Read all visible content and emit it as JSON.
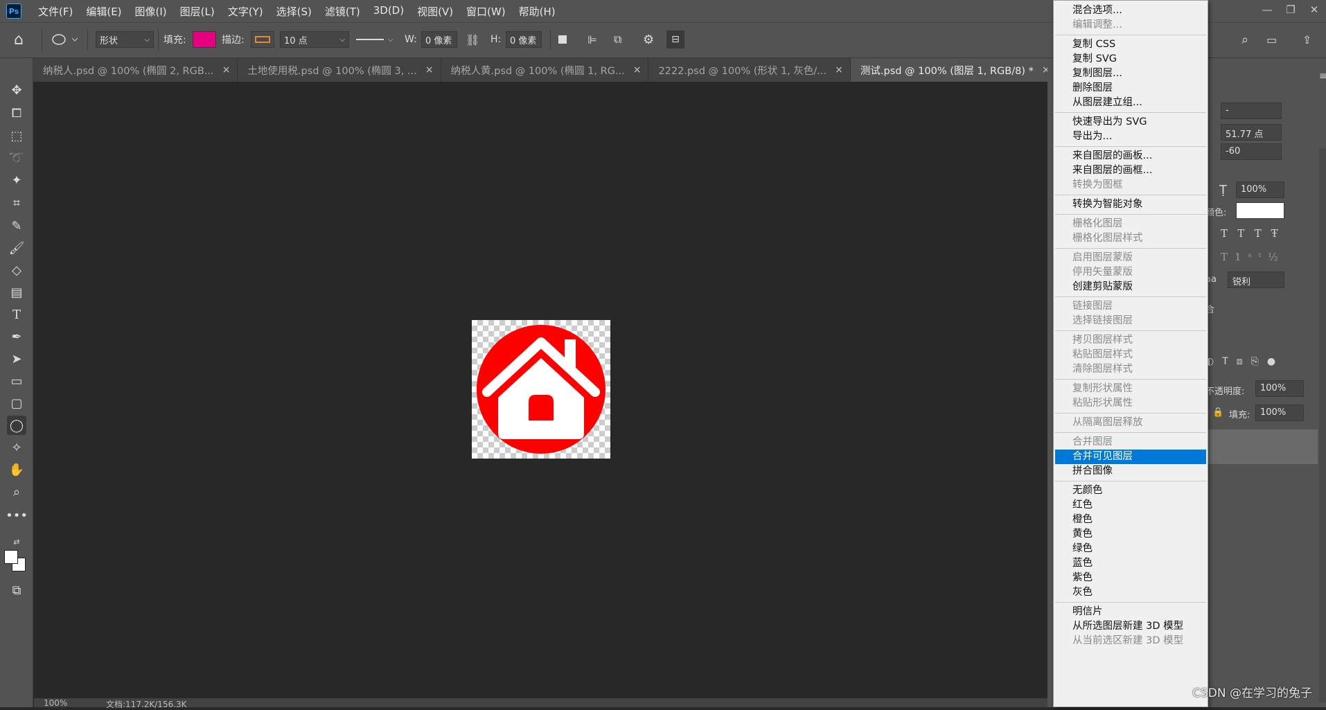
{
  "app": {
    "logo": "Ps"
  },
  "menubar": [
    "文件(F)",
    "编辑(E)",
    "图像(I)",
    "图层(L)",
    "文字(Y)",
    "选择(S)",
    "滤镜(T)",
    "3D(D)",
    "视图(V)",
    "窗口(W)",
    "帮助(H)"
  ],
  "options": {
    "mode": "形状",
    "fill_label": "填充:",
    "fill_color": "#e5007f",
    "stroke_label": "描边:",
    "stroke_size": "10 点",
    "w_label": "W:",
    "w_value": "0 像素",
    "h_label": "H:",
    "h_value": "0 像素"
  },
  "tabs": [
    {
      "label": "纳税人.psd @ 100% (椭圆 2, RGB..."
    },
    {
      "label": "土地使用税.psd @ 100% (椭圆 3, ..."
    },
    {
      "label": "纳税人黄.psd @ 100% (椭圆 1, RG..."
    },
    {
      "label": "2222.psd @ 100% (形状 1, 灰色/..."
    },
    {
      "label": "测试.psd @ 100% (图层 1, RGB/8) *"
    }
  ],
  "status": {
    "zoom": "100%",
    "doc": "文档:117.2K/156.3K"
  },
  "right_panel": {
    "dash_value": "-",
    "size_value": "51.77 点",
    "tracking_value": "-60",
    "scale_value": "100%",
    "color_label": "颜色:",
    "aa_label": "aa",
    "aa_value": "锐利",
    "blend_tab": "合",
    "opacity_label": "不透明度:",
    "opacity_value": "100%",
    "fill_label": "填充:",
    "fill_value": "100%"
  },
  "context_menu": [
    {
      "label": "混合选项...",
      "disabled": false
    },
    {
      "label": "编辑调整...",
      "disabled": true
    },
    {
      "sep": true
    },
    {
      "label": "复制 CSS",
      "disabled": false
    },
    {
      "label": "复制 SVG",
      "disabled": false
    },
    {
      "label": "复制图层...",
      "disabled": false
    },
    {
      "label": "删除图层",
      "disabled": false
    },
    {
      "label": "从图层建立组...",
      "disabled": false
    },
    {
      "sep": true
    },
    {
      "label": "快速导出为 SVG",
      "disabled": false
    },
    {
      "label": "导出为...",
      "disabled": false
    },
    {
      "sep": true
    },
    {
      "label": "来自图层的画板...",
      "disabled": false
    },
    {
      "label": "来自图层的画框...",
      "disabled": false
    },
    {
      "label": "转换为图框",
      "disabled": true
    },
    {
      "sep": true
    },
    {
      "label": "转换为智能对象",
      "disabled": false
    },
    {
      "sep": true
    },
    {
      "label": "栅格化图层",
      "disabled": true
    },
    {
      "label": "栅格化图层样式",
      "disabled": true
    },
    {
      "sep": true
    },
    {
      "label": "启用图层蒙版",
      "disabled": true
    },
    {
      "label": "停用矢量蒙版",
      "disabled": true
    },
    {
      "label": "创建剪贴蒙版",
      "disabled": false
    },
    {
      "sep": true
    },
    {
      "label": "链接图层",
      "disabled": true
    },
    {
      "label": "选择链接图层",
      "disabled": true
    },
    {
      "sep": true
    },
    {
      "label": "拷贝图层样式",
      "disabled": true
    },
    {
      "label": "粘贴图层样式",
      "disabled": true
    },
    {
      "label": "清除图层样式",
      "disabled": true
    },
    {
      "sep": true
    },
    {
      "label": "复制形状属性",
      "disabled": true
    },
    {
      "label": "粘贴形状属性",
      "disabled": true
    },
    {
      "sep": true
    },
    {
      "label": "从隔离图层释放",
      "disabled": true
    },
    {
      "sep": true
    },
    {
      "label": "合并图层",
      "disabled": true
    },
    {
      "label": "合并可见图层",
      "disabled": false,
      "highlighted": true
    },
    {
      "label": "拼合图像",
      "disabled": false
    },
    {
      "sep": true
    },
    {
      "label": "无颜色",
      "disabled": false
    },
    {
      "label": "红色",
      "disabled": false
    },
    {
      "label": "橙色",
      "disabled": false
    },
    {
      "label": "黄色",
      "disabled": false
    },
    {
      "label": "绿色",
      "disabled": false
    },
    {
      "label": "蓝色",
      "disabled": false
    },
    {
      "label": "紫色",
      "disabled": false
    },
    {
      "label": "灰色",
      "disabled": false
    },
    {
      "sep": true
    },
    {
      "label": "明信片",
      "disabled": false
    },
    {
      "label": "从所选图层新建 3D 模型",
      "disabled": false
    },
    {
      "label": "从当前选区新建 3D 模型",
      "disabled": true
    }
  ],
  "watermark": "CSDN @在学习的兔子",
  "colors": {
    "accent": "#0078d7",
    "logo_red": "#ff0000"
  }
}
